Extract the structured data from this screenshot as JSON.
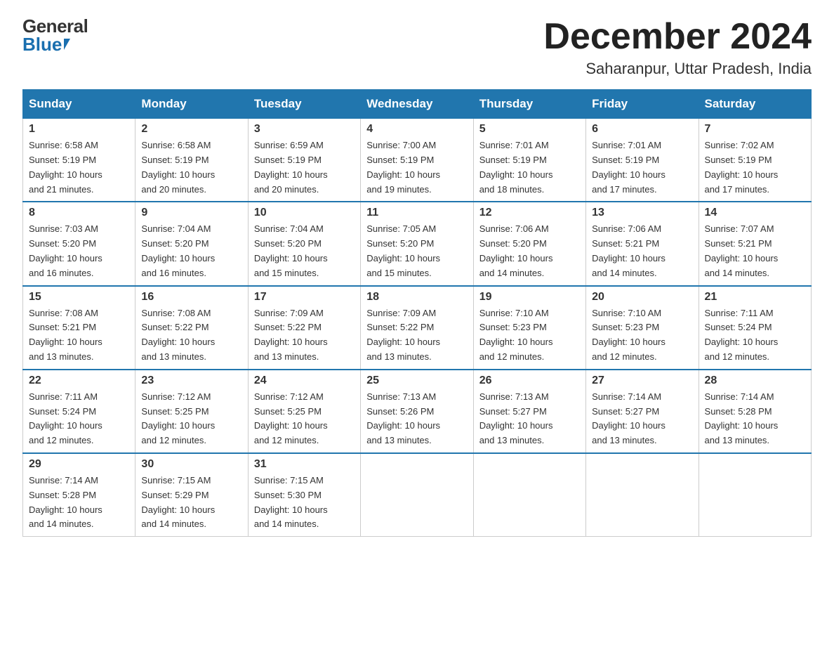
{
  "header": {
    "logo_general": "General",
    "logo_blue": "Blue",
    "month_title": "December 2024",
    "location": "Saharanpur, Uttar Pradesh, India"
  },
  "days_of_week": [
    "Sunday",
    "Monday",
    "Tuesday",
    "Wednesday",
    "Thursday",
    "Friday",
    "Saturday"
  ],
  "weeks": [
    [
      {
        "day": "1",
        "sunrise": "6:58 AM",
        "sunset": "5:19 PM",
        "daylight": "10 hours and 21 minutes."
      },
      {
        "day": "2",
        "sunrise": "6:58 AM",
        "sunset": "5:19 PM",
        "daylight": "10 hours and 20 minutes."
      },
      {
        "day": "3",
        "sunrise": "6:59 AM",
        "sunset": "5:19 PM",
        "daylight": "10 hours and 20 minutes."
      },
      {
        "day": "4",
        "sunrise": "7:00 AM",
        "sunset": "5:19 PM",
        "daylight": "10 hours and 19 minutes."
      },
      {
        "day": "5",
        "sunrise": "7:01 AM",
        "sunset": "5:19 PM",
        "daylight": "10 hours and 18 minutes."
      },
      {
        "day": "6",
        "sunrise": "7:01 AM",
        "sunset": "5:19 PM",
        "daylight": "10 hours and 17 minutes."
      },
      {
        "day": "7",
        "sunrise": "7:02 AM",
        "sunset": "5:19 PM",
        "daylight": "10 hours and 17 minutes."
      }
    ],
    [
      {
        "day": "8",
        "sunrise": "7:03 AM",
        "sunset": "5:20 PM",
        "daylight": "10 hours and 16 minutes."
      },
      {
        "day": "9",
        "sunrise": "7:04 AM",
        "sunset": "5:20 PM",
        "daylight": "10 hours and 16 minutes."
      },
      {
        "day": "10",
        "sunrise": "7:04 AM",
        "sunset": "5:20 PM",
        "daylight": "10 hours and 15 minutes."
      },
      {
        "day": "11",
        "sunrise": "7:05 AM",
        "sunset": "5:20 PM",
        "daylight": "10 hours and 15 minutes."
      },
      {
        "day": "12",
        "sunrise": "7:06 AM",
        "sunset": "5:20 PM",
        "daylight": "10 hours and 14 minutes."
      },
      {
        "day": "13",
        "sunrise": "7:06 AM",
        "sunset": "5:21 PM",
        "daylight": "10 hours and 14 minutes."
      },
      {
        "day": "14",
        "sunrise": "7:07 AM",
        "sunset": "5:21 PM",
        "daylight": "10 hours and 14 minutes."
      }
    ],
    [
      {
        "day": "15",
        "sunrise": "7:08 AM",
        "sunset": "5:21 PM",
        "daylight": "10 hours and 13 minutes."
      },
      {
        "day": "16",
        "sunrise": "7:08 AM",
        "sunset": "5:22 PM",
        "daylight": "10 hours and 13 minutes."
      },
      {
        "day": "17",
        "sunrise": "7:09 AM",
        "sunset": "5:22 PM",
        "daylight": "10 hours and 13 minutes."
      },
      {
        "day": "18",
        "sunrise": "7:09 AM",
        "sunset": "5:22 PM",
        "daylight": "10 hours and 13 minutes."
      },
      {
        "day": "19",
        "sunrise": "7:10 AM",
        "sunset": "5:23 PM",
        "daylight": "10 hours and 12 minutes."
      },
      {
        "day": "20",
        "sunrise": "7:10 AM",
        "sunset": "5:23 PM",
        "daylight": "10 hours and 12 minutes."
      },
      {
        "day": "21",
        "sunrise": "7:11 AM",
        "sunset": "5:24 PM",
        "daylight": "10 hours and 12 minutes."
      }
    ],
    [
      {
        "day": "22",
        "sunrise": "7:11 AM",
        "sunset": "5:24 PM",
        "daylight": "10 hours and 12 minutes."
      },
      {
        "day": "23",
        "sunrise": "7:12 AM",
        "sunset": "5:25 PM",
        "daylight": "10 hours and 12 minutes."
      },
      {
        "day": "24",
        "sunrise": "7:12 AM",
        "sunset": "5:25 PM",
        "daylight": "10 hours and 12 minutes."
      },
      {
        "day": "25",
        "sunrise": "7:13 AM",
        "sunset": "5:26 PM",
        "daylight": "10 hours and 13 minutes."
      },
      {
        "day": "26",
        "sunrise": "7:13 AM",
        "sunset": "5:27 PM",
        "daylight": "10 hours and 13 minutes."
      },
      {
        "day": "27",
        "sunrise": "7:14 AM",
        "sunset": "5:27 PM",
        "daylight": "10 hours and 13 minutes."
      },
      {
        "day": "28",
        "sunrise": "7:14 AM",
        "sunset": "5:28 PM",
        "daylight": "10 hours and 13 minutes."
      }
    ],
    [
      {
        "day": "29",
        "sunrise": "7:14 AM",
        "sunset": "5:28 PM",
        "daylight": "10 hours and 14 minutes."
      },
      {
        "day": "30",
        "sunrise": "7:15 AM",
        "sunset": "5:29 PM",
        "daylight": "10 hours and 14 minutes."
      },
      {
        "day": "31",
        "sunrise": "7:15 AM",
        "sunset": "5:30 PM",
        "daylight": "10 hours and 14 minutes."
      },
      null,
      null,
      null,
      null
    ]
  ],
  "labels": {
    "sunrise": "Sunrise:",
    "sunset": "Sunset:",
    "daylight": "Daylight:"
  }
}
